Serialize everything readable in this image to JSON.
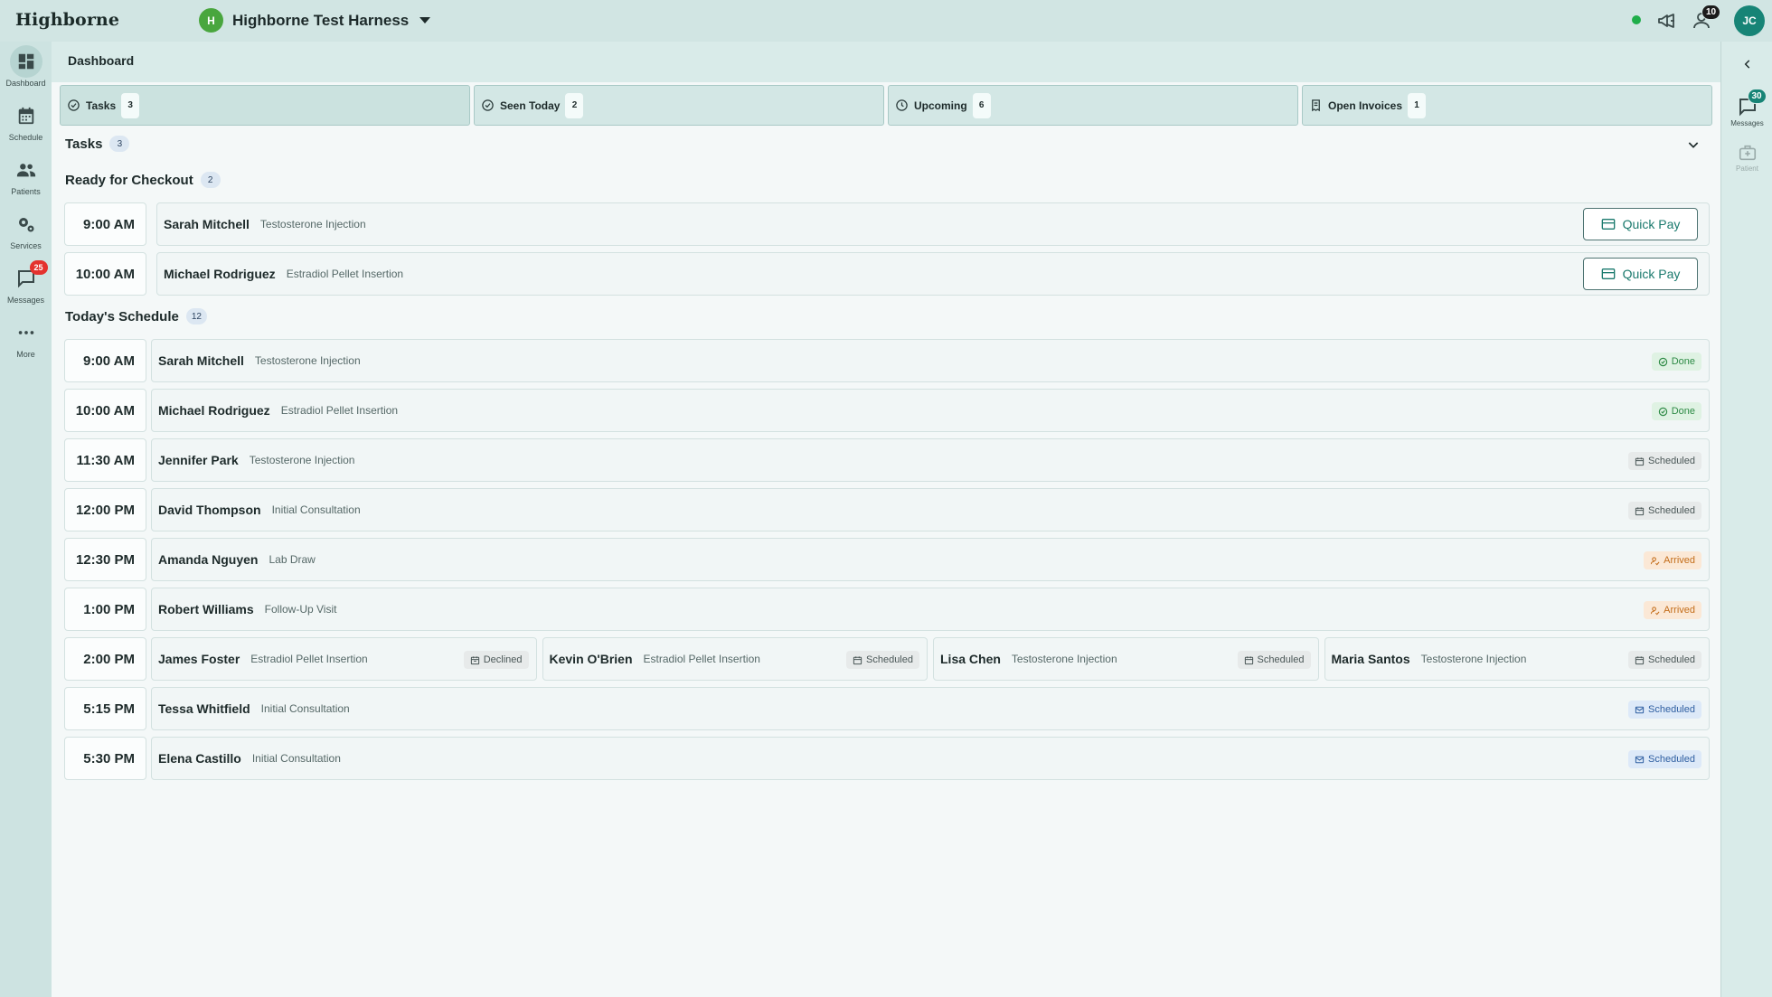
{
  "header": {
    "brand": "Highborne",
    "org_initial": "H",
    "org_name": "Highborne Test Harness",
    "notification_count": "10",
    "user_initials": "JC"
  },
  "leftnav": {
    "items": [
      {
        "label": "Dashboard",
        "icon": "dashboard-icon"
      },
      {
        "label": "Schedule",
        "icon": "calendar-icon"
      },
      {
        "label": "Patients",
        "icon": "people-icon"
      },
      {
        "label": "Services",
        "icon": "gear-icon"
      },
      {
        "label": "Messages",
        "icon": "chat-icon",
        "badge": "25"
      },
      {
        "label": "More",
        "icon": "more-icon"
      }
    ]
  },
  "rightpanel": {
    "messages_label": "Messages",
    "messages_badge": "30",
    "patient_label": "Patient"
  },
  "page": {
    "title": "Dashboard"
  },
  "tabs": [
    {
      "label": "Tasks",
      "count": "3",
      "icon": "check-circle-icon"
    },
    {
      "label": "Seen Today",
      "count": "2",
      "icon": "check-circle-icon"
    },
    {
      "label": "Upcoming",
      "count": "6",
      "icon": "clock-icon"
    },
    {
      "label": "Open Invoices",
      "count": "1",
      "icon": "invoice-icon"
    }
  ],
  "tasks": {
    "title": "Tasks",
    "count": "3"
  },
  "checkout": {
    "title": "Ready for Checkout",
    "count": "2",
    "button_label": "Quick Pay",
    "rows": [
      {
        "time": "9:00 AM",
        "name": "Sarah Mitchell",
        "service": "Testosterone Injection"
      },
      {
        "time": "10:00 AM",
        "name": "Michael Rodriguez",
        "service": "Estradiol Pellet Insertion"
      }
    ]
  },
  "schedule": {
    "title": "Today's Schedule",
    "count": "12",
    "rows": [
      {
        "time": "9:00 AM",
        "appts": [
          {
            "name": "Sarah Mitchell",
            "service": "Testosterone Injection",
            "status": "Done",
            "kind": "done"
          }
        ]
      },
      {
        "time": "10:00 AM",
        "appts": [
          {
            "name": "Michael Rodriguez",
            "service": "Estradiol Pellet Insertion",
            "status": "Done",
            "kind": "done"
          }
        ]
      },
      {
        "time": "11:30 AM",
        "appts": [
          {
            "name": "Jennifer Park",
            "service": "Testosterone Injection",
            "status": "Scheduled",
            "kind": "sched"
          }
        ]
      },
      {
        "time": "12:00 PM",
        "appts": [
          {
            "name": "David Thompson",
            "service": "Initial Consultation",
            "status": "Scheduled",
            "kind": "sched"
          }
        ]
      },
      {
        "time": "12:30 PM",
        "appts": [
          {
            "name": "Amanda Nguyen",
            "service": "Lab Draw",
            "status": "Arrived",
            "kind": "arrived"
          }
        ]
      },
      {
        "time": "1:00 PM",
        "appts": [
          {
            "name": "Robert Williams",
            "service": "Follow-Up Visit",
            "status": "Arrived",
            "kind": "arrived"
          }
        ]
      },
      {
        "time": "2:00 PM",
        "appts": [
          {
            "name": "James Foster",
            "service": "Estradiol Pellet Insertion",
            "status": "Declined",
            "kind": "declined"
          },
          {
            "name": "Kevin O'Brien",
            "service": "Estradiol Pellet Insertion",
            "status": "Scheduled",
            "kind": "sched"
          },
          {
            "name": "Lisa Chen",
            "service": "Testosterone Injection",
            "status": "Scheduled",
            "kind": "sched"
          },
          {
            "name": "Maria Santos",
            "service": "Testosterone Injection",
            "status": "Scheduled",
            "kind": "sched"
          }
        ]
      },
      {
        "time": "5:15 PM",
        "appts": [
          {
            "name": "Tessa Whitfield",
            "service": "Initial Consultation",
            "status": "Scheduled",
            "kind": "sched-blue"
          }
        ]
      },
      {
        "time": "5:30 PM",
        "appts": [
          {
            "name": "Elena Castillo",
            "service": "Initial Consultation",
            "status": "Scheduled",
            "kind": "sched-blue"
          }
        ]
      }
    ]
  },
  "colors": {
    "accent": "#178476",
    "done": "#2d8a45",
    "arrived": "#c36d1a",
    "scheduled_blue": "#2f5fa1",
    "badge_red": "#e4322e",
    "online": "#1fae4a"
  }
}
